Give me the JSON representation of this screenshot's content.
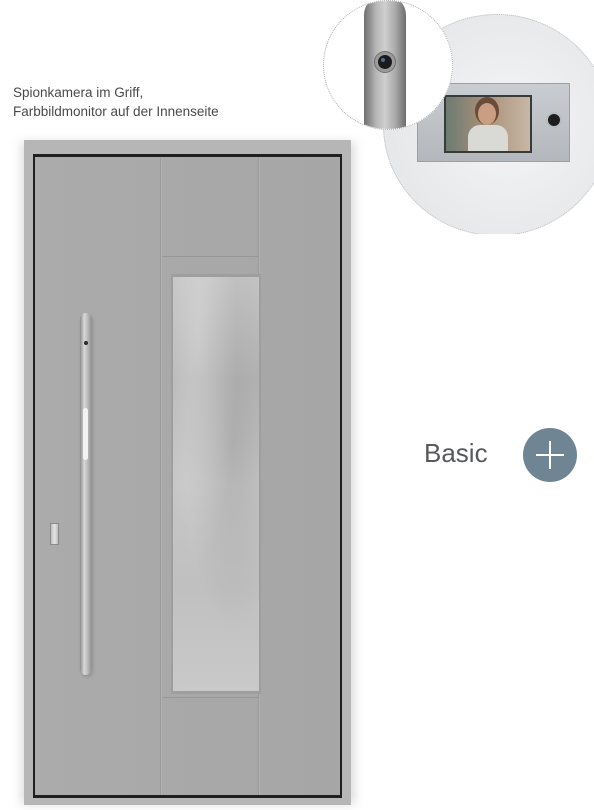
{
  "caption": {
    "line1": "Spionkamera im Griff,",
    "line2": "Farbbildmonitor auf der Innenseite"
  },
  "basic_button": {
    "label": "Basic",
    "icon": "plus-icon",
    "color": "#6f8593"
  },
  "colors": {
    "door_gray": "#a9a9a9",
    "label_text": "#58595b"
  }
}
